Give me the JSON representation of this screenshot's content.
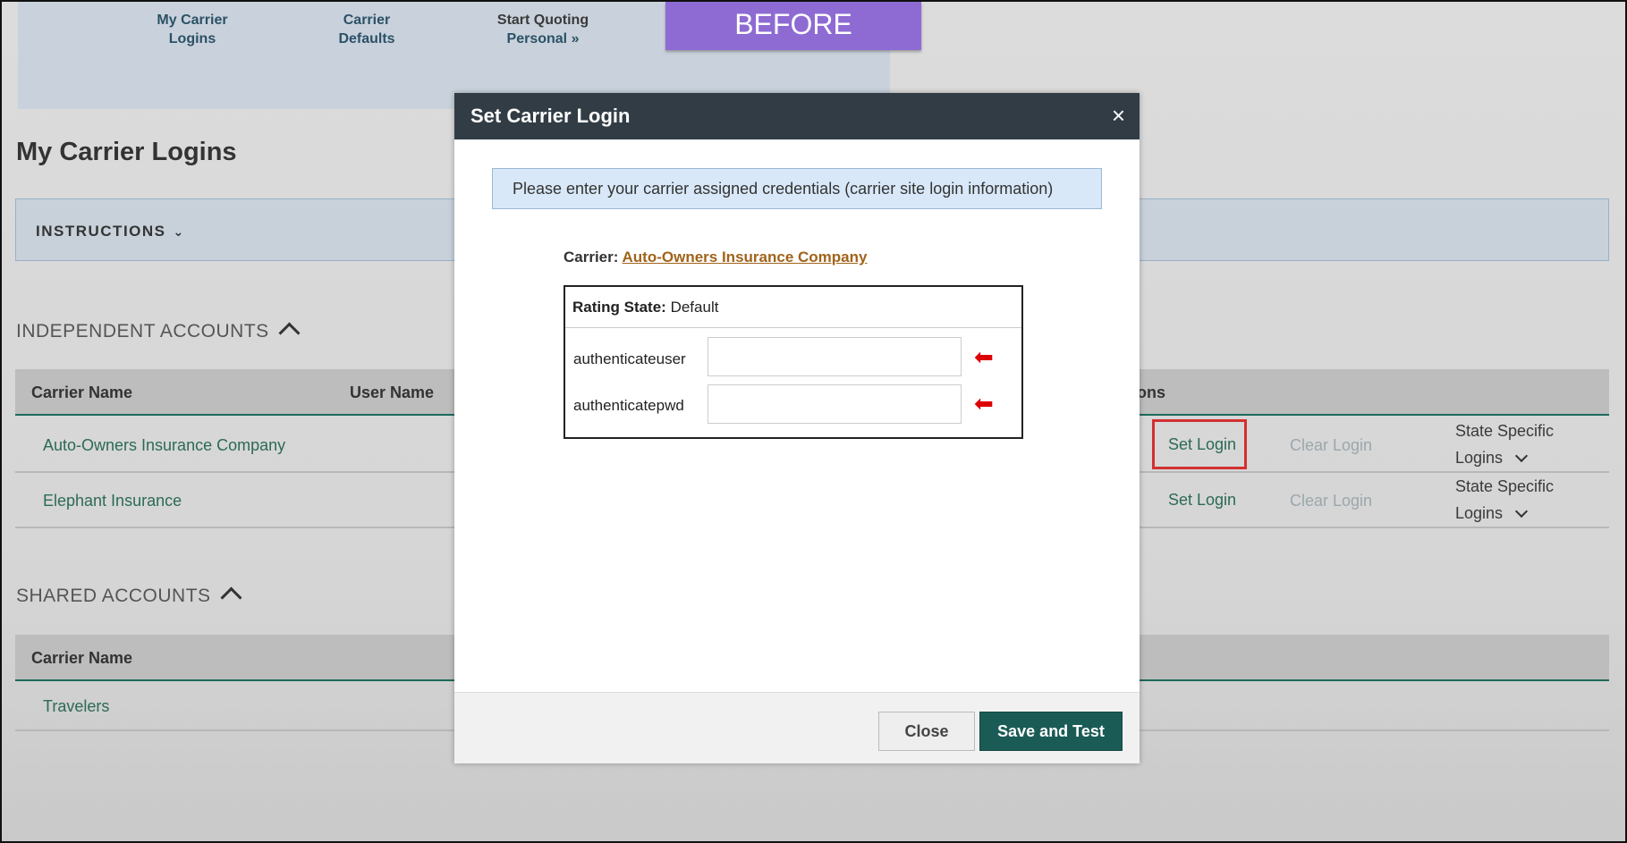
{
  "nav": {
    "items": [
      {
        "line1": "My Carrier",
        "line2": "Logins"
      },
      {
        "line1": "Carrier",
        "line2": "Defaults"
      },
      {
        "line1": "Start Quoting",
        "line2": "Personal »"
      }
    ]
  },
  "banner": "BEFORE",
  "page_title": "My Carrier Logins",
  "instructions_label": "INSTRUCTIONS",
  "independent": {
    "title": "INDEPENDENT ACCOUNTS",
    "columns": [
      "Carrier Name",
      "User Name",
      "ons"
    ],
    "rows": [
      {
        "carrier": "Auto-Owners Insurance Company",
        "set_login": "Set Login",
        "clear_login": "Clear Login",
        "state_line1": "State Specific",
        "state_line2": "Logins"
      },
      {
        "carrier": "Elephant Insurance",
        "set_login": "Set Login",
        "clear_login": "Clear Login",
        "state_line1": "State Specific",
        "state_line2": "Logins"
      }
    ]
  },
  "shared": {
    "title": "SHARED ACCOUNTS",
    "columns": [
      "Carrier Name"
    ],
    "rows": [
      {
        "carrier": "Travelers"
      }
    ]
  },
  "modal": {
    "title": "Set Carrier Login",
    "close_glyph": "×",
    "info": "Please enter your carrier assigned credentials (carrier site login information)",
    "carrier_label": "Carrier:",
    "carrier_name": "Auto-Owners Insurance Company",
    "rating_state_label": "Rating State:",
    "rating_state_value": "Default",
    "fields": [
      {
        "label": "authenticateuser",
        "value": ""
      },
      {
        "label": "authenticatepwd",
        "value": ""
      }
    ],
    "arrow_glyph": "⬅",
    "close_button": "Close",
    "save_button": "Save and Test"
  },
  "colors": {
    "header_dark": "#323c44",
    "save_button": "#1b5b56",
    "link_green": "#2c6a55",
    "banner_purple": "#8e6bd3",
    "highlight_red": "#d23030",
    "arrow_red": "#dd0000"
  }
}
